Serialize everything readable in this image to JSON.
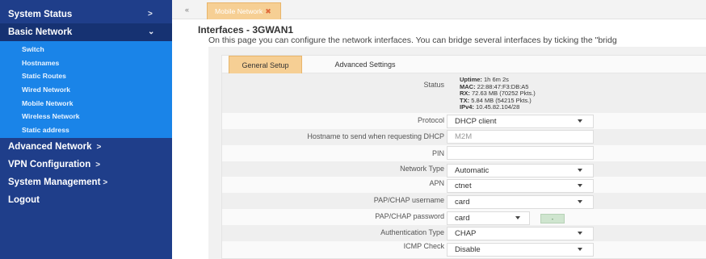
{
  "sidebar": {
    "items": [
      {
        "label": "System Status",
        "chev": ">"
      },
      {
        "label": "Basic Network",
        "chev": "⌄"
      },
      {
        "label": "Advanced Network",
        "chev": ">"
      },
      {
        "label": "VPN Configuration",
        "chev": ">"
      },
      {
        "label": "System Management",
        "chev": ">"
      },
      {
        "label": "Logout"
      }
    ],
    "subitems": [
      {
        "label": "Switch"
      },
      {
        "label": "Hostnames"
      },
      {
        "label": "Static Routes"
      },
      {
        "label": "Wired Network"
      },
      {
        "label": "Mobile Network"
      },
      {
        "label": "Wireless Network"
      },
      {
        "label": "Static address"
      }
    ]
  },
  "tabstrip": {
    "back_icon": "«",
    "active_tab": "Mobile Network",
    "close_icon": "✖"
  },
  "page": {
    "title": "Interfaces - 3GWAN1",
    "description": "On this page you can configure the network interfaces. You can bridge several interfaces by ticking the \"bridg"
  },
  "tabs": {
    "general": "General Setup",
    "advanced": "Advanced Settings"
  },
  "status": {
    "label": "Status",
    "uptime_key": "Uptime:",
    "uptime": "1h 6m 2s",
    "mac_key": "MAC:",
    "mac": "22:88:47:F3:DB:A5",
    "rx_key": "RX:",
    "rx": "72.63 MB (70252 Pkts.)",
    "tx_key": "TX:",
    "tx": "5.84 MB (54215 Pkts.)",
    "ipv4_key": "IPv4:",
    "ipv4": "10.45.82.104/28"
  },
  "form": {
    "protocol": {
      "label": "Protocol",
      "value": "DHCP client"
    },
    "hostname": {
      "label": "Hostname to send when requesting DHCP",
      "placeholder": "M2M"
    },
    "pin": {
      "label": "PIN",
      "value": ""
    },
    "network_type": {
      "label": "Network Type",
      "value": "Automatic"
    },
    "apn": {
      "label": "APN",
      "value": "ctnet"
    },
    "username": {
      "label": "PAP/CHAP username",
      "value": "card"
    },
    "password": {
      "label": "PAP/CHAP password",
      "value": "card",
      "toggle": "-"
    },
    "auth_type": {
      "label": "Authentication Type",
      "value": "CHAP"
    },
    "icmp_check": {
      "label": "ICMP Check",
      "value": "Disable"
    }
  },
  "colors": {
    "sidebar_bg": "#1f3e8a",
    "submenu_bg": "#1a84e8",
    "tab_active": "#f6cf94"
  }
}
